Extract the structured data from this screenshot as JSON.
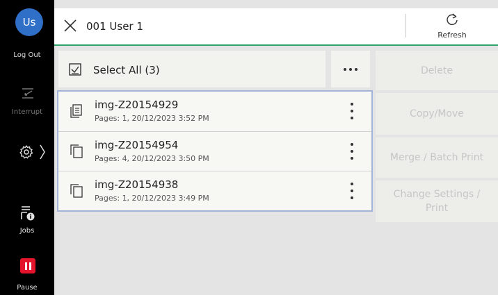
{
  "sidebar": {
    "user_initials": "Us",
    "logout_label": "Log Out",
    "interrupt_label": "Interrupt",
    "jobs_label": "Jobs",
    "pause_label": "Pause",
    "colors": {
      "avatar": "#2f6fc7",
      "pause": "#e5142d"
    }
  },
  "header": {
    "title": "001 User 1",
    "refresh_label": "Refresh",
    "accent_color": "#2ea36a"
  },
  "list": {
    "select_all_label": "Select All (3)",
    "files": [
      {
        "name": "img-Z20154929",
        "meta": "Pages: 1, 20/12/2023 3:52 PM",
        "icon": "multi-document-icon"
      },
      {
        "name": "img-Z20154954",
        "meta": "Pages: 4, 20/12/2023 3:50 PM",
        "icon": "copy-document-icon"
      },
      {
        "name": "img-Z20154938",
        "meta": "Pages: 1, 20/12/2023 3:49 PM",
        "icon": "copy-document-icon"
      }
    ]
  },
  "actions": {
    "delete_label": "Delete",
    "copy_move_label": "Copy/Move",
    "merge_label": "Merge / Batch Print",
    "change_settings_label": "Change Settings / Print"
  }
}
